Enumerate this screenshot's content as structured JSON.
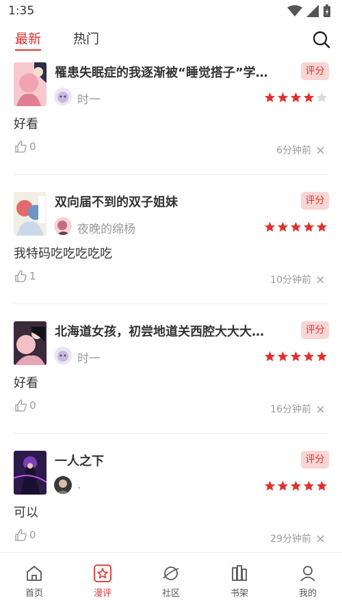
{
  "status_bar": {
    "time": "1:35"
  },
  "tabs": {
    "latest": "最新",
    "hot": "热门"
  },
  "badge_label": "评分",
  "posts": [
    {
      "title": "罹患失眠症的我逐渐被“睡觉搭子”学…",
      "user": "时一",
      "rating": 4,
      "comment": "好看",
      "likes": "0",
      "time": "6分钟前"
    },
    {
      "title": "双向届不到的双子姐妹",
      "user": "夜晚的绵杨",
      "rating": 5,
      "comment": "我特码吃吃吃吃吃",
      "likes": "1",
      "time": "10分钟前"
    },
    {
      "title": "北海道女孩，初尝地道关西腔大大大…",
      "user": "时一",
      "rating": 5,
      "comment": "好看",
      "likes": "0",
      "time": "16分钟前"
    },
    {
      "title": "一人之下",
      "user": ".",
      "rating": 5,
      "comment": "可以",
      "likes": "0",
      "time": "29分钟前"
    }
  ],
  "nav": {
    "home": "首页",
    "review": "漫评",
    "community": "社区",
    "shelf": "书架",
    "mine": "我的"
  },
  "colors": {
    "accent": "#e0312f",
    "star_off": "#d8d8d8"
  }
}
